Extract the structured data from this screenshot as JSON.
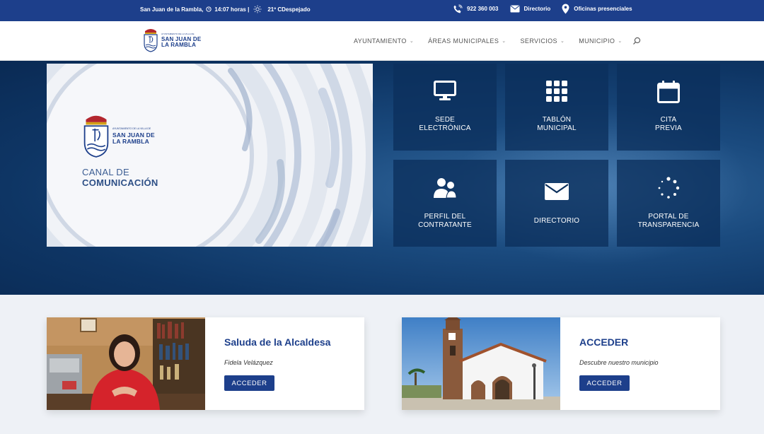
{
  "topbar": {
    "location_time": "San Juan de la Rambla,",
    "time": "14:07 horas |",
    "weather": "21º CDespejado",
    "phone": "922 360 003",
    "directorio": "Directorio",
    "oficinas": "Oficinas presenciales"
  },
  "logo": {
    "small": "AYUNTAMIENTO DE LA VILLA DE",
    "line1": "SAN JUAN DE",
    "line2": "LA RAMBLA"
  },
  "nav": {
    "items": [
      "AYUNTAMIENTO",
      "ÁREAS MUNICIPALES",
      "SERVICIOS",
      "MUNICIPIO"
    ]
  },
  "hero": {
    "canal_line1": "CANAL DE",
    "canal_line2": "COMUNICACIÓN",
    "tiles": [
      {
        "line1": "SEDE",
        "line2": "ELECTRÓNICA",
        "icon": "monitor-icon"
      },
      {
        "line1": "TABLÓN",
        "line2": "MUNICIPAL",
        "icon": "grid-icon"
      },
      {
        "line1": "CITA",
        "line2": "PREVIA",
        "icon": "calendar-icon"
      },
      {
        "line1": "PERFIL DEL",
        "line2": "CONTRATANTE",
        "icon": "users-icon"
      },
      {
        "line1": "DIRECTORIO",
        "line2": "",
        "icon": "envelope-icon"
      },
      {
        "line1": "PORTAL DE",
        "line2": "TRANSPARENCIA",
        "icon": "spinner-icon"
      }
    ]
  },
  "cards": [
    {
      "title": "Saluda de la Alcaldesa",
      "subtitle": "Fidela Velázquez",
      "button": "ACCEDER"
    },
    {
      "title": "ACCEDER",
      "subtitle": "Descubre nuestro municipio",
      "button": "ACCEDER"
    }
  ],
  "colors": {
    "brand": "#1d3f8b",
    "hero_dark": "#0a2a54"
  }
}
